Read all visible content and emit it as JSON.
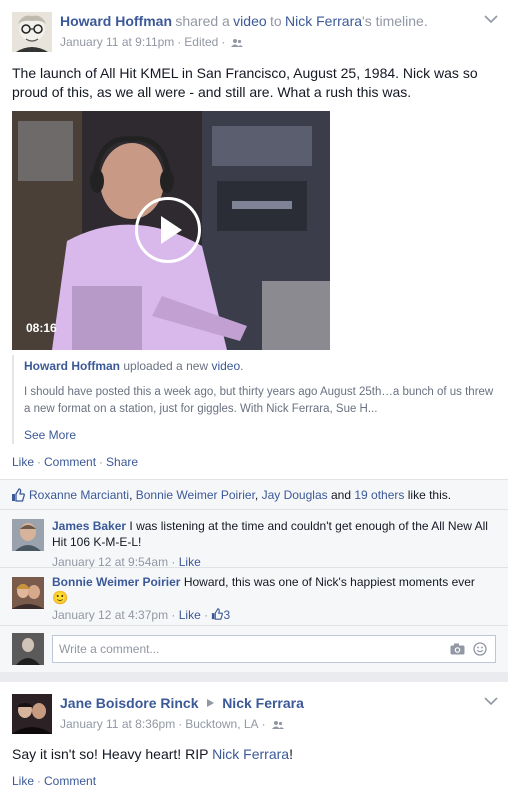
{
  "post1": {
    "author": "Howard Hoffman",
    "shared_text": "shared a",
    "shared_object": "video",
    "to_text": "to",
    "target": "Nick Ferrara",
    "target_suffix": "'s timeline.",
    "timestamp": "January 11 at 9:11pm",
    "edited": "Edited",
    "message": "The launch of All Hit KMEL in San Francisco, August 25, 1984. Nick was so proud of this, as we all were - and still are. What a rush this was.",
    "video": {
      "duration": "08:16"
    },
    "attachment": {
      "author": "Howard Hoffman",
      "action": "uploaded a new",
      "object": "video",
      "period": ".",
      "description": "I should have posted this a week ago, but thirty years ago August 25th…a bunch of us threw a new format on a station, just for giggles. With Nick Ferrara, Sue H...",
      "see_more": "See More"
    },
    "actions": {
      "like": "Like",
      "comment": "Comment",
      "share": "Share"
    },
    "likes": {
      "names": [
        "Roxanne Marcianti",
        "Bonnie Weimer Poirier",
        "Jay Douglas"
      ],
      "and_text": "and",
      "others": "19 others",
      "suffix": "like this."
    },
    "comments": [
      {
        "author": "James Baker",
        "text": "I was listening at the time and couldn't get enough of the All New All Hit 106 K-M-E-L!",
        "time": "January 12 at 9:54am",
        "like": "Like"
      },
      {
        "author": "Bonnie Weimer Poirier",
        "text": "Howard, this was one of Nick's happiest moments ever",
        "emoji": "🙂",
        "time": "January 12 at 4:37pm",
        "like": "Like",
        "like_count": "3"
      }
    ],
    "write_comment_placeholder": "Write a comment..."
  },
  "post2": {
    "author": "Jane Boisdore Rinck",
    "target": "Nick Ferrara",
    "timestamp": "January 11 at 8:36pm",
    "location": "Bucktown, LA",
    "message_prefix": "Say it isn't so! Heavy heart! RIP",
    "message_link": "Nick Ferrara",
    "message_suffix": "!",
    "actions": {
      "like": "Like",
      "comment": "Comment"
    }
  },
  "colors": {
    "link": "#3b5998",
    "meta_gray": "#9197a3",
    "ufi_bg": "#f6f7f9"
  }
}
